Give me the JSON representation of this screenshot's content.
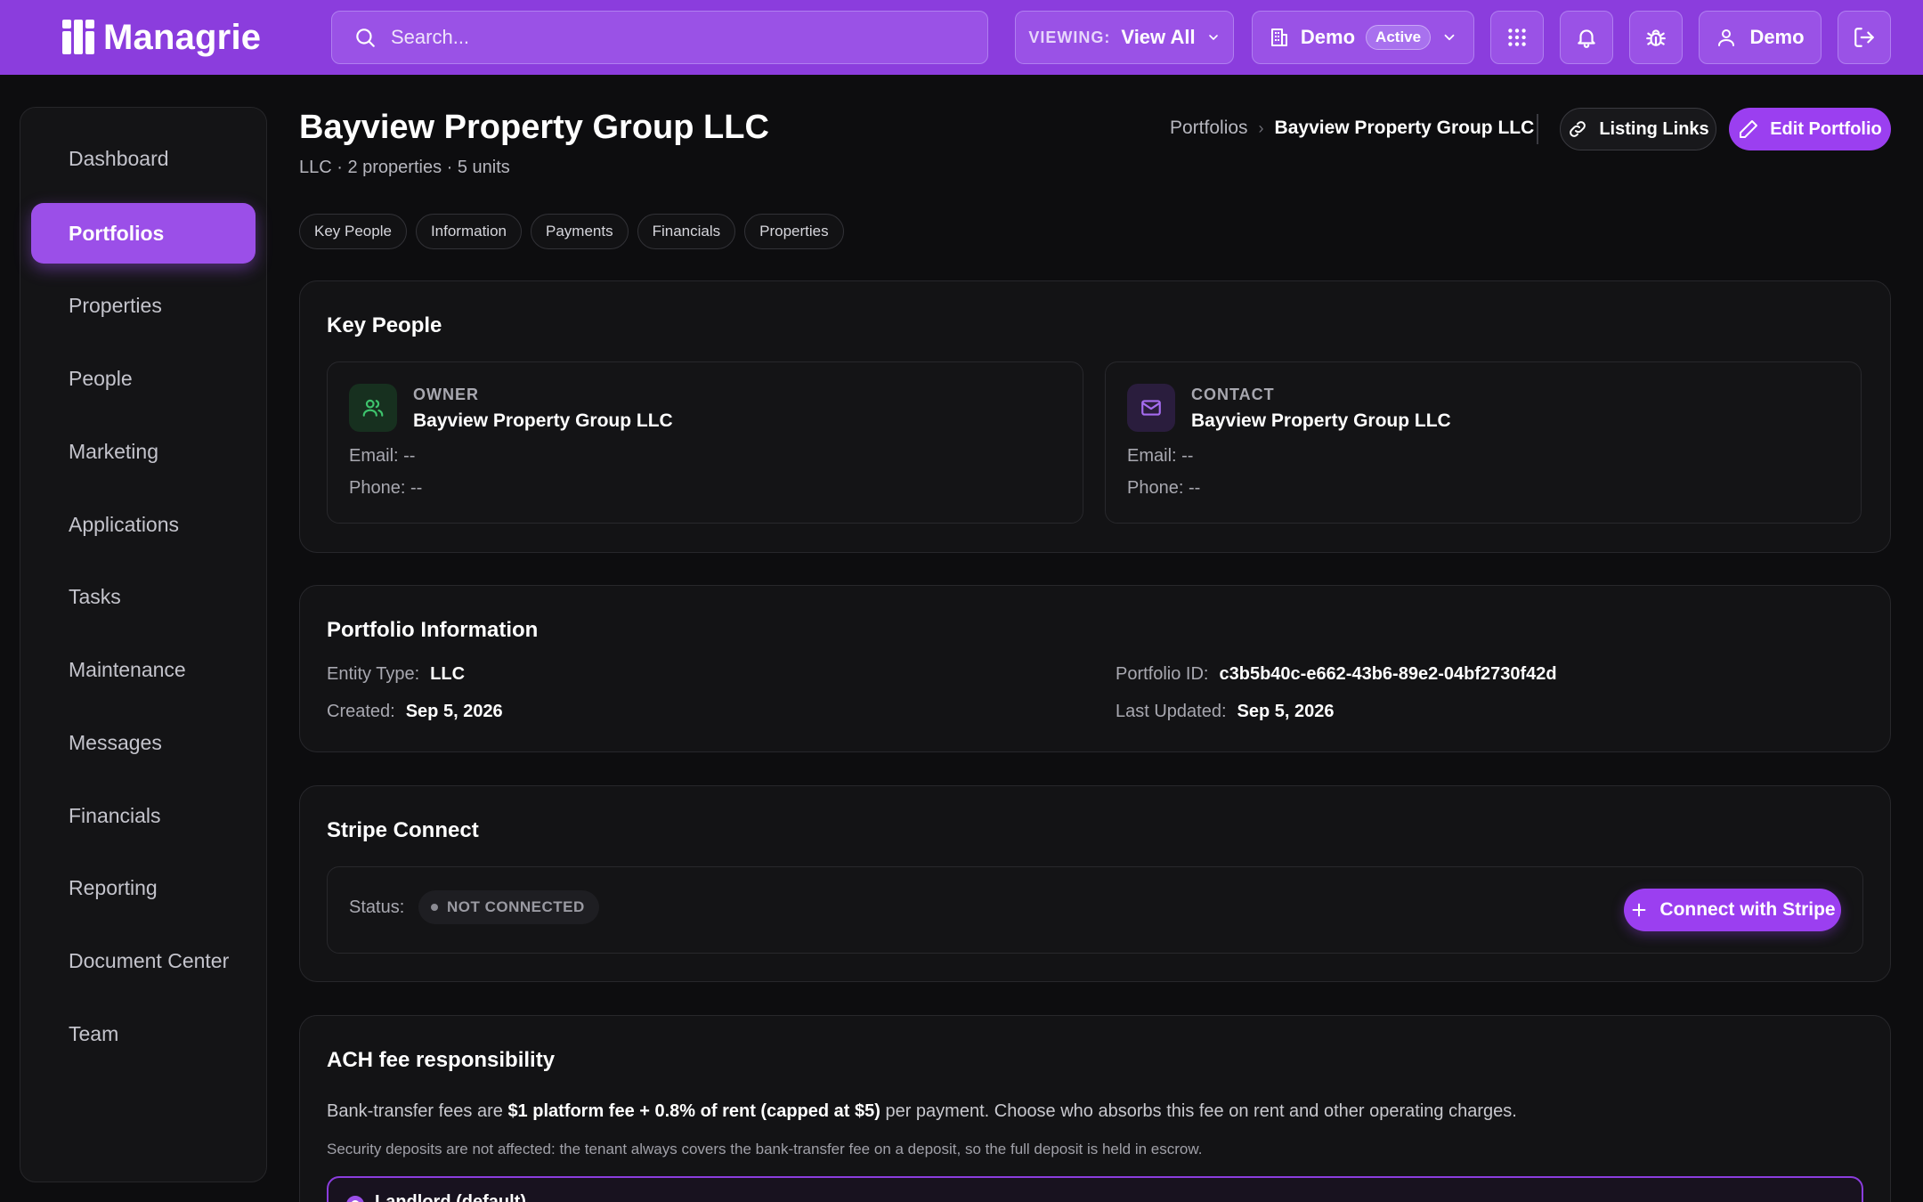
{
  "app": {
    "name": "Managrie"
  },
  "topbar": {
    "search_placeholder": "Search...",
    "viewing_label": "VIEWING:",
    "viewing_value": "View All",
    "org_name": "Demo",
    "org_status": "Active",
    "user_name": "Demo"
  },
  "sidebar": {
    "items": [
      {
        "label": "Dashboard"
      },
      {
        "label": "Portfolios",
        "active": true
      },
      {
        "label": "Properties"
      },
      {
        "label": "People"
      },
      {
        "label": "Marketing"
      },
      {
        "label": "Applications"
      },
      {
        "label": "Tasks"
      },
      {
        "label": "Maintenance"
      },
      {
        "label": "Messages"
      },
      {
        "label": "Financials"
      },
      {
        "label": "Reporting"
      },
      {
        "label": "Document Center"
      },
      {
        "label": "Team"
      }
    ]
  },
  "header": {
    "title": "Bayview Property Group LLC",
    "subtitle": "LLC · 2 properties · 5 units",
    "breadcrumb": {
      "parent": "Portfolios",
      "separator": "›",
      "current": "Bayview Property Group LLC"
    },
    "listing_links_label": "Listing Links",
    "edit_label": "Edit Portfolio"
  },
  "tabs": [
    {
      "label": "Key People"
    },
    {
      "label": "Information"
    },
    {
      "label": "Payments"
    },
    {
      "label": "Financials"
    },
    {
      "label": "Properties"
    }
  ],
  "key_people": {
    "title": "Key People",
    "owner": {
      "role": "OWNER",
      "name": "Bayview Property Group LLC",
      "email": "Email: --",
      "phone": "Phone: --"
    },
    "contact": {
      "role": "CONTACT",
      "name": "Bayview Property Group LLC",
      "email": "Email: --",
      "phone": "Phone: --"
    }
  },
  "portfolio_info": {
    "title": "Portfolio Information",
    "entity_type_label": "Entity Type:",
    "entity_type": "LLC",
    "created_label": "Created:",
    "created": "Sep 5, 2026",
    "id_label": "Portfolio ID:",
    "id": "c3b5b40c-e662-43b6-89e2-04bf2730f42d",
    "updated_label": "Last Updated:",
    "updated": "Sep 5, 2026"
  },
  "stripe": {
    "title": "Stripe Connect",
    "status_label": "Status:",
    "status": "NOT CONNECTED",
    "connect_label": "Connect with Stripe"
  },
  "ach": {
    "title": "ACH fee responsibility",
    "text_before": "Bank-transfer fees are ",
    "text_bold": "$1 platform fee + 0.8% of rent (capped at $5)",
    "text_after": " per payment. Choose who absorbs this fee on rent and other operating charges.",
    "note": "Security deposits are not affected: the tenant always covers the bank-transfer fee on a deposit, so the full deposit is held in escrow.",
    "option_label": "Landlord (default)"
  },
  "colors": {
    "brand": "#8b3ddd",
    "accent": "#9b3ff0",
    "background": "#0d0d0f",
    "card": "#131315",
    "owner_icon": "#3ec46d",
    "contact_icon": "#a56cf0"
  }
}
